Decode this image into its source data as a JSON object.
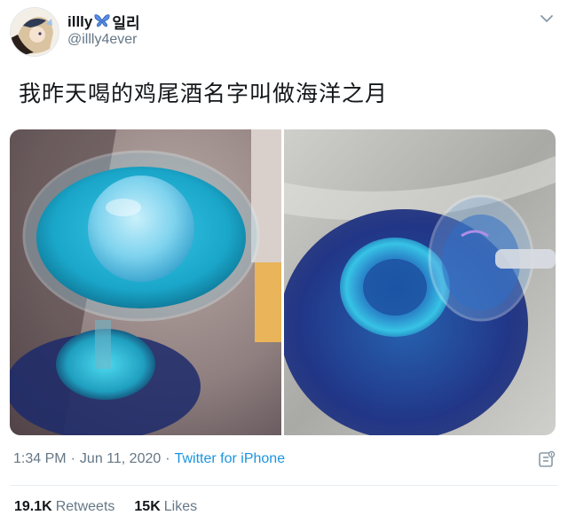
{
  "user": {
    "display_name": "illly",
    "display_name_suffix": "일리",
    "handle": "@illly4ever"
  },
  "tweet": {
    "text": "我昨天喝的鸡尾酒名字叫做海洋之月"
  },
  "media": {
    "photos": [
      "cocktail-glass-photo",
      "glass-shadow-photo"
    ],
    "accent_color": "#1aa6c9"
  },
  "meta": {
    "time": "1:34 PM",
    "separator1": "·",
    "date": "Jun 11, 2020",
    "separator2": "·",
    "source": "Twitter for iPhone"
  },
  "stats": {
    "retweets_count": "19.1K",
    "retweets_label": "Retweets",
    "likes_count": "15K",
    "likes_label": "Likes"
  },
  "icons": {
    "caret": "chevron-down-icon",
    "analytics": "analytics-icon",
    "name_emoji": "butterfly-icon"
  },
  "colors": {
    "link": "#1b95e0",
    "secondary_text": "#657786",
    "primary_text": "#14171a"
  }
}
